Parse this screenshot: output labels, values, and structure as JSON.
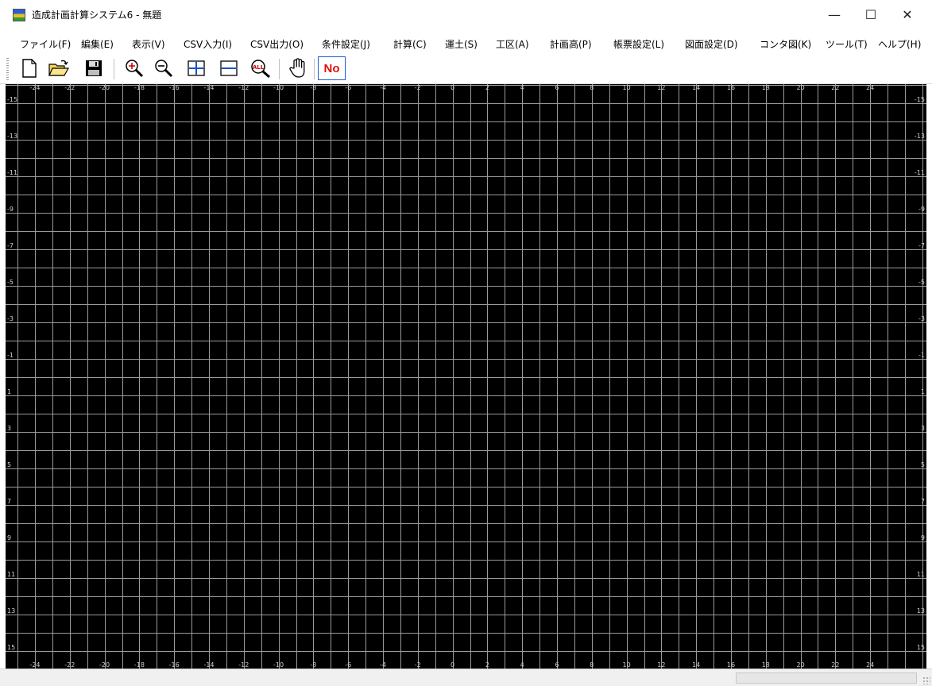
{
  "window": {
    "title": "造成計画計算システム6 - 無題",
    "minimize_symbol": "—",
    "maximize_symbol": "☐",
    "close_symbol": "✕"
  },
  "menu": [
    "ファイル(F)",
    "編集(E)",
    "表示(V)",
    "CSV入力(I)",
    "CSV出力(O)",
    "条件設定(J)",
    "計算(C)",
    "運土(S)",
    "工区(A)",
    "計画高(P)",
    "帳票設定(L)",
    "図面設定(D)",
    "コンタ図(K)",
    "ツール(T)",
    "ヘルプ(H)"
  ],
  "toolbar": {
    "buttons": [
      {
        "name": "new-file-icon"
      },
      {
        "name": "open-folder-icon"
      },
      {
        "name": "save-icon"
      },
      {
        "name": "zoom-in-icon"
      },
      {
        "name": "zoom-out-icon"
      },
      {
        "name": "zoom-fit-icon"
      },
      {
        "name": "zoom-width-icon"
      },
      {
        "name": "zoom-all-icon",
        "text": "ALL"
      },
      {
        "name": "pan-hand-icon"
      }
    ],
    "no_label": "No"
  },
  "grid": {
    "background": "#000000",
    "line_color": "#9a9a9a",
    "label_color": "#d0d0d0",
    "x_labels": [
      "-24",
      "-22",
      "-20",
      "-18",
      "-16",
      "-14",
      "-12",
      "-10",
      "-8",
      "-6",
      "-4",
      "-2",
      "0",
      "2",
      "4",
      "6",
      "8",
      "10",
      "12",
      "14",
      "16",
      "18",
      "20",
      "22",
      "24"
    ],
    "y_labels": [
      "-15",
      "-13",
      "-11",
      "-9",
      "-7",
      "-5",
      "-3",
      "-1",
      "1",
      "3",
      "5",
      "7",
      "9",
      "11",
      "13",
      "15"
    ]
  }
}
